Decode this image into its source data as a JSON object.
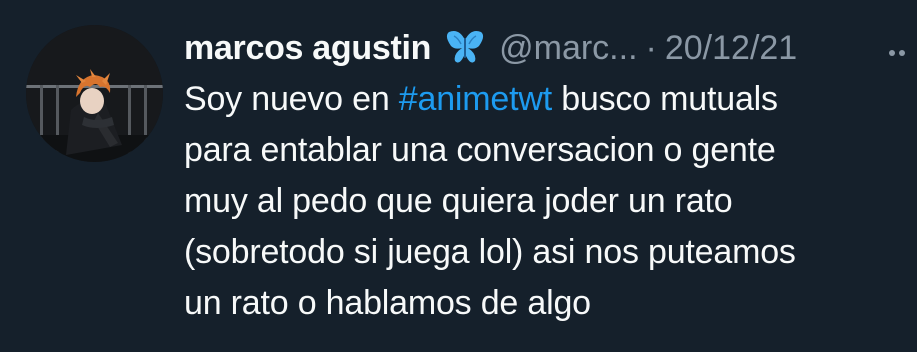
{
  "tweet": {
    "display_name": "marcos agustin",
    "badge_icon": "butterfly-emoji",
    "handle": "@marc...",
    "separator": "·",
    "date": "20/12/21",
    "more_icon": "more-icon",
    "body": {
      "line1_pre": "Soy nuevo en ",
      "hashtag": "#animetwt",
      "line1_post": " busco mutuals",
      "line2": "para entablar una conversacion o gente",
      "line3": "muy al pedo que quiera joder un rato",
      "line4": "(sobretodo si juega lol) asi nos puteamos",
      "line5": "un rato o hablamos de algo"
    }
  },
  "colors": {
    "background": "#15202b",
    "text": "#f7f9f9",
    "secondary": "#8b98a5",
    "link": "#1d9bf0",
    "badge": "#4ab3f4"
  }
}
